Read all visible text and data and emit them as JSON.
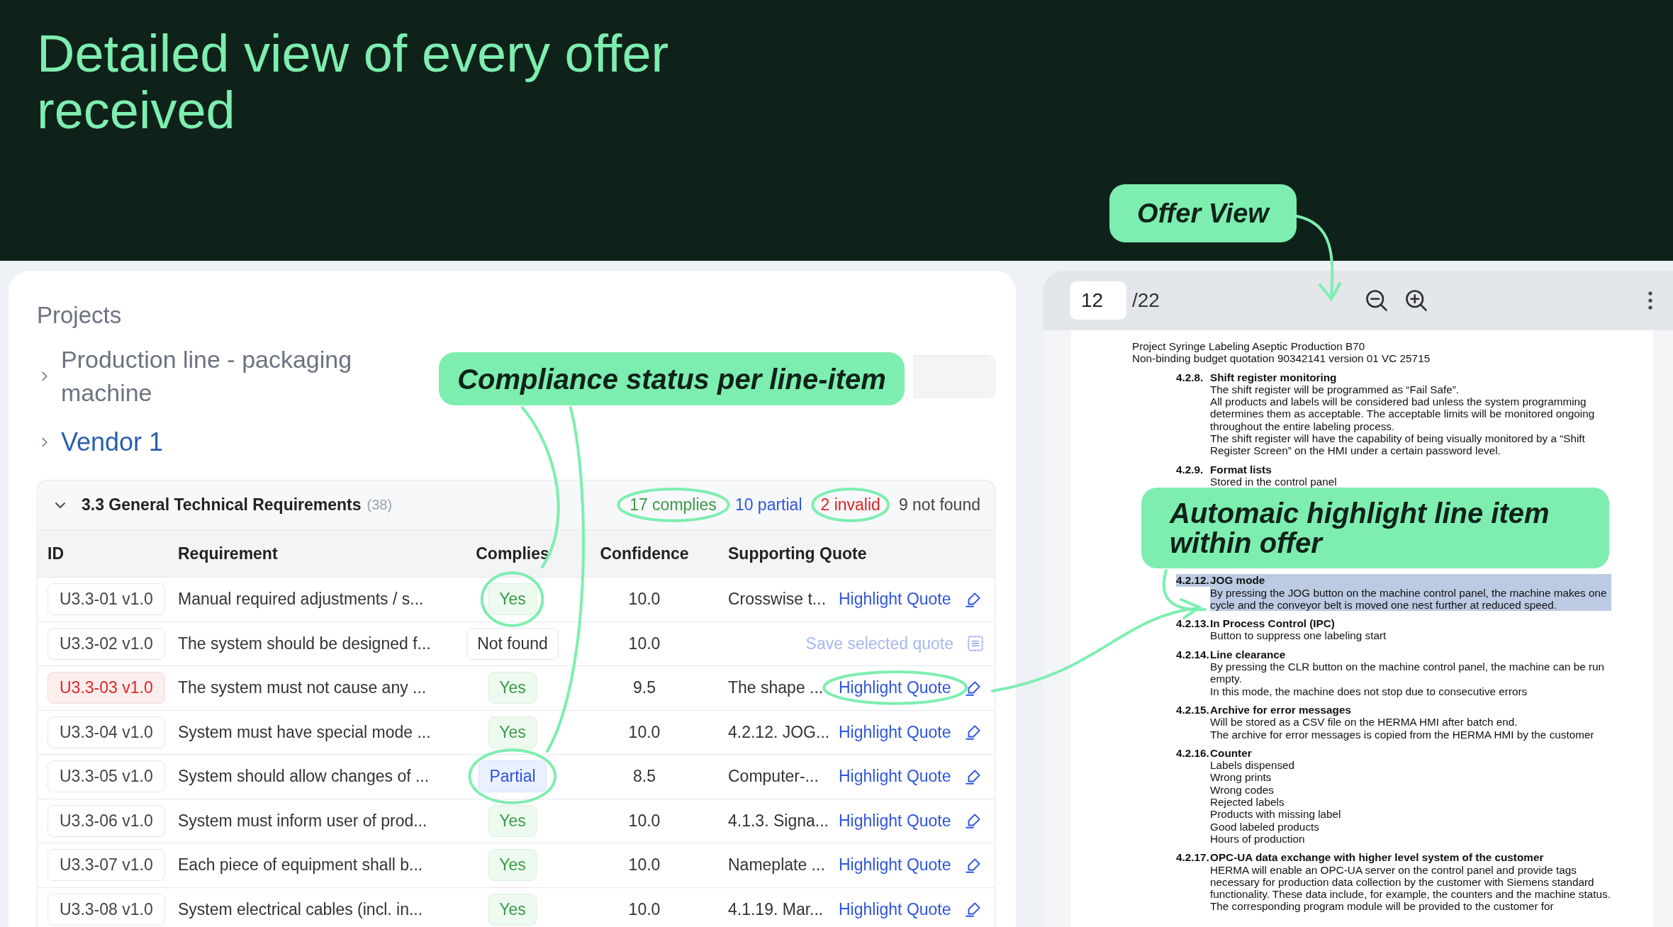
{
  "headline": "Detailed view of every offer received",
  "callouts": [
    {
      "text": "Offer View"
    },
    {
      "text": "Compliance status per line-item"
    },
    {
      "text": "Automaic highlight line item within offer"
    }
  ],
  "projects": {
    "title": "Projects",
    "items": [
      {
        "label": "Production line - packaging machine",
        "expanded": false,
        "selected": false
      },
      {
        "label": "Vendor 1",
        "expanded": false,
        "selected": true
      }
    ]
  },
  "section": {
    "title": "3.3 General Technical Requirements",
    "count": "(38)",
    "expanded": true,
    "summary": [
      {
        "kind": "complies",
        "text": "17 complies"
      },
      {
        "kind": "partial",
        "text": "10 partial"
      },
      {
        "kind": "invalid",
        "text": "2 invalid"
      },
      {
        "kind": "not_found",
        "text": "9 not found"
      }
    ]
  },
  "table": {
    "columns": [
      "ID",
      "Requirement",
      "Complies",
      "Confidence",
      "Supporting Quote"
    ],
    "rows": [
      {
        "id": "U3.3-01 v1.0",
        "invalid": false,
        "requirement": "Manual required adjustments / s...",
        "complies": {
          "kind": "yes",
          "text": "Yes"
        },
        "confidence": "10.0",
        "quote": "Crosswise t...",
        "action": {
          "kind": "highlight",
          "text": "Highlight Quote"
        }
      },
      {
        "id": "U3.3-02 v1.0",
        "invalid": false,
        "requirement": "The system should be designed f...",
        "complies": {
          "kind": "not_found",
          "text": "Not found"
        },
        "confidence": "10.0",
        "action": {
          "kind": "save",
          "text": "Save selected quote"
        }
      },
      {
        "id": "U3.3-03 v1.0",
        "invalid": true,
        "requirement": "The system must not cause any ...",
        "complies": {
          "kind": "yes",
          "text": "Yes"
        },
        "confidence": "9.5",
        "quote": "The shape ...",
        "action": {
          "kind": "highlight",
          "text": "Highlight Quote"
        }
      },
      {
        "id": "U3.3-04 v1.0",
        "invalid": false,
        "requirement": "System must have special mode ...",
        "complies": {
          "kind": "yes",
          "text": "Yes"
        },
        "confidence": "10.0",
        "quote": "4.2.12. JOG...",
        "action": {
          "kind": "highlight",
          "text": "Highlight Quote"
        }
      },
      {
        "id": "U3.3-05 v1.0",
        "invalid": false,
        "requirement": "System should allow changes of ...",
        "complies": {
          "kind": "partial",
          "text": "Partial"
        },
        "confidence": "8.5",
        "quote": "Computer-...",
        "action": {
          "kind": "highlight",
          "text": "Highlight Quote"
        }
      },
      {
        "id": "U3.3-06 v1.0",
        "invalid": false,
        "requirement": "System must inform user of prod...",
        "complies": {
          "kind": "yes",
          "text": "Yes"
        },
        "confidence": "10.0",
        "quote": "4.1.3. Signa...",
        "action": {
          "kind": "highlight",
          "text": "Highlight Quote"
        }
      },
      {
        "id": "U3.3-07 v1.0",
        "invalid": false,
        "requirement": "Each piece of equipment shall b...",
        "complies": {
          "kind": "yes",
          "text": "Yes"
        },
        "confidence": "10.0",
        "quote": "Nameplate ...",
        "action": {
          "kind": "highlight",
          "text": "Highlight Quote"
        }
      },
      {
        "id": "U3.3-08 v1.0",
        "invalid": false,
        "requirement": "System electrical cables (incl. in...",
        "complies": {
          "kind": "yes",
          "text": "Yes"
        },
        "confidence": "10.0",
        "quote": "4.1.19. Mar...",
        "action": {
          "kind": "highlight",
          "text": "Highlight Quote"
        }
      }
    ]
  },
  "viewer": {
    "page": "12",
    "pages": "/22",
    "document": {
      "header": [
        "Project Syringe Labeling Aseptic Production B70",
        "Non-binding budget quotation 90342141 version 01 VC 25715"
      ],
      "sections": [
        {
          "number": "4.2.8.",
          "title": "Shift register monitoring",
          "highlighted": false,
          "lines": [
            "The shift register will be programmed as “Fail Safe”.",
            "All products and labels will be considered bad unless the system programming determines them as acceptable. The acceptable limits will be monitored ongoing throughout the entire labeling process.",
            "The shift register will have the capability of being visually monitored by a “Shift Register Screen” on the HMI under a certain password level."
          ]
        },
        {
          "number": "4.2.9.",
          "title": "Format lists",
          "highlighted": false,
          "lines": [
            "Stored in the control panel"
          ]
        },
        {
          "number": "4.2.12.",
          "title": "JOG mode",
          "highlighted": true,
          "lines": [
            "By pressing the JOG button on the machine control panel, the machine makes one cycle and the conveyor belt is moved one nest further at reduced speed."
          ]
        },
        {
          "number": "4.2.13.",
          "title": "In Process Control (IPC)",
          "highlighted": false,
          "lines": [
            "Button to suppress one labeling start"
          ]
        },
        {
          "number": "4.2.14.",
          "title": "Line clearance",
          "highlighted": false,
          "lines": [
            "By pressing the CLR button on the machine control panel, the machine can be run empty.",
            "In this mode, the machine does not stop due to consecutive errors"
          ]
        },
        {
          "number": "4.2.15.",
          "title": "Archive for error messages",
          "highlighted": false,
          "lines": [
            "Will be stored as a CSV file on the HERMA HMI after batch end.",
            "The archive for error messages is copied from the HERMA HMI by the customer"
          ]
        },
        {
          "number": "4.2.16.",
          "title": "Counter",
          "highlighted": false,
          "lines": [
            "Labels dispensed",
            "Wrong prints",
            "Wrong codes",
            "Rejected labels",
            "Products with missing label",
            "Good labeled products",
            "Hours of production"
          ]
        },
        {
          "number": "4.2.17.",
          "title": "OPC-UA data exchange with higher level system of the customer",
          "highlighted": false,
          "lines": [
            "HERMA will enable an OPC-UA server on the control panel and provide tags necessary for production data collection by the customer with Siemens standard functionality. These data include, for example, the counters and the machine status.",
            "The corresponding program module will be provided to the customer for"
          ]
        }
      ]
    }
  }
}
